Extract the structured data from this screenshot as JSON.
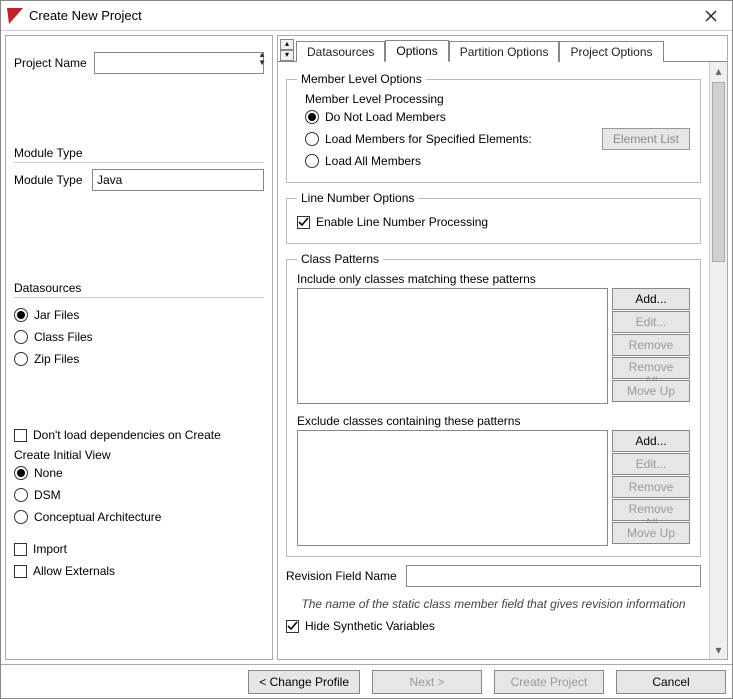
{
  "window": {
    "title": "Create New Project"
  },
  "left": {
    "projectNameLabel": "Project Name",
    "projectNameValue": "",
    "moduleTypeHead": "Module Type",
    "moduleTypeLabel": "Module Type",
    "moduleTypeValue": "Java",
    "datasourcesHead": "Datasources",
    "dsJar": "Jar Files",
    "dsClass": "Class Files",
    "dsZip": "Zip Files",
    "dontLoad": "Don't load dependencies on Create",
    "createInitial": "Create Initial View",
    "viewNone": "None",
    "viewDSM": "DSM",
    "viewCA": "Conceptual Architecture",
    "import": "Import",
    "allowExternals": "Allow Externals"
  },
  "tabs": {
    "datasources": "Datasources",
    "options": "Options",
    "partition": "Partition Options",
    "project": "Project Options"
  },
  "opts": {
    "memberLevelOptions": "Member Level Options",
    "memberLevelProcessing": "Member Level Processing",
    "doNotLoad": "Do Not Load Members",
    "loadSpecified": "Load Members for Specified Elements:",
    "loadAll": "Load All Members",
    "elementList": "Element List",
    "lineNumberOptions": "Line Number Options",
    "enableLineNumber": "Enable Line Number Processing",
    "classPatterns": "Class Patterns",
    "includeLabel": "Include only classes matching these patterns",
    "excludeLabel": "Exclude classes containing these patterns",
    "add": "Add...",
    "edit": "Edit...",
    "remove": "Remove",
    "removeAll": "Remove All",
    "moveUp": "Move Up",
    "revisionLabel": "Revision Field Name",
    "revisionValue": "",
    "hint": "The name of the static class member field that gives revision information",
    "hideSynthetic": "Hide Synthetic Variables"
  },
  "footer": {
    "changeProfile": "< Change Profile",
    "next": "Next >",
    "createProject": "Create Project",
    "cancel": "Cancel"
  }
}
